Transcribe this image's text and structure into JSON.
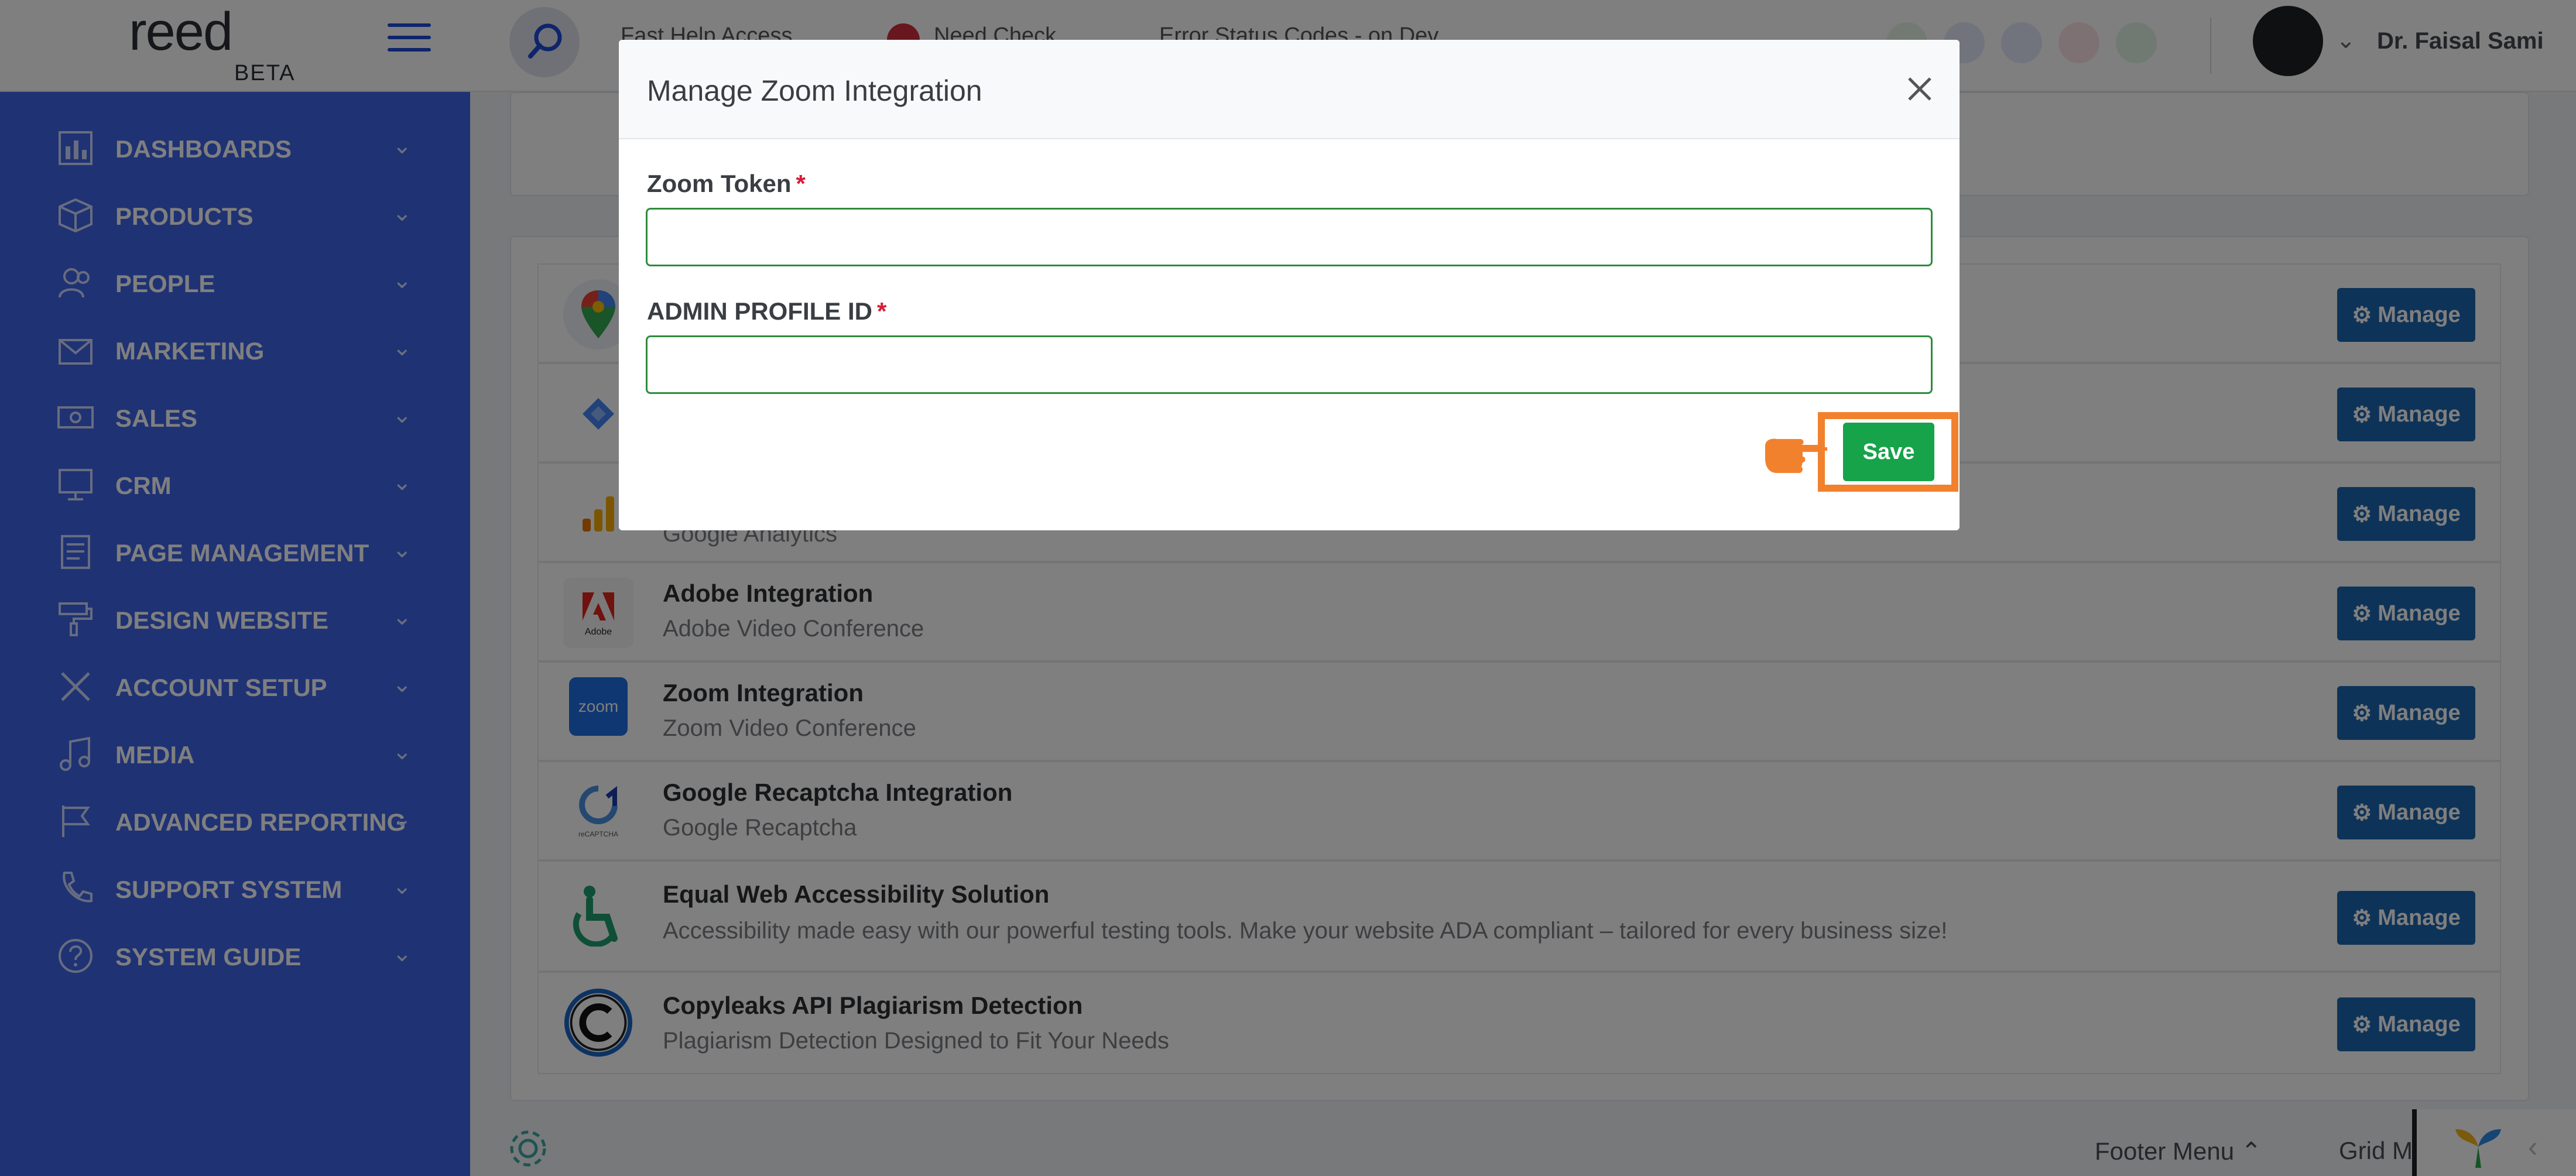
{
  "app": {
    "logo_text": "reed",
    "logo_badge": "BETA",
    "quick_links": [
      "Fast Help Access",
      "Need Check",
      "Error Status Codes - on Dev"
    ],
    "user_name": "Dr. Faisal Sami"
  },
  "sidebar": {
    "items": [
      {
        "label": "DASHBOARDS",
        "icon": "dashboard-icon"
      },
      {
        "label": "PRODUCTS",
        "icon": "box-icon"
      },
      {
        "label": "PEOPLE",
        "icon": "people-icon"
      },
      {
        "label": "MARKETING",
        "icon": "mail-icon"
      },
      {
        "label": "SALES",
        "icon": "cash-icon"
      },
      {
        "label": "CRM",
        "icon": "monitor-icon"
      },
      {
        "label": "PAGE MANAGEMENT",
        "icon": "page-icon"
      },
      {
        "label": "DESIGN WEBSITE",
        "icon": "paint-roller-icon"
      },
      {
        "label": "ACCOUNT SETUP",
        "icon": "tools-icon"
      },
      {
        "label": "MEDIA",
        "icon": "music-icon"
      },
      {
        "label": "ADVANCED REPORTING",
        "icon": "flag-icon"
      },
      {
        "label": "SUPPORT SYSTEM",
        "icon": "phone-icon"
      },
      {
        "label": "SYSTEM GUIDE",
        "icon": "help-icon"
      }
    ]
  },
  "integrations": {
    "manage_label": "Manage",
    "rows": [
      {
        "title": "",
        "desc": "",
        "logo": "google-maps-icon"
      },
      {
        "title": "",
        "desc": "",
        "logo": "google-tag-icon"
      },
      {
        "title": "",
        "desc": "Google Analytics",
        "logo": "google-analytics-icon"
      },
      {
        "title": "Adobe Integration",
        "desc": "Adobe Video Conference",
        "logo": "adobe-icon"
      },
      {
        "title": "Zoom Integration",
        "desc": "Zoom Video Conference",
        "logo": "zoom-icon"
      },
      {
        "title": "Google Recaptcha Integration",
        "desc": "Google Recaptcha",
        "logo": "recaptcha-icon"
      },
      {
        "title": "Equal Web Accessibility Solution",
        "desc": "Accessibility made easy with our powerful testing tools. Make your website ADA compliant – tailored for every business size!",
        "logo": "accessibility-icon"
      },
      {
        "title": "Copyleaks API Plagiarism Detection",
        "desc": "Plagiarism Detection Designed to Fit Your Needs",
        "logo": "copyleaks-icon"
      }
    ]
  },
  "footer": {
    "footer_menu": "Footer Menu",
    "grid_menu": "Grid Menu"
  },
  "modal": {
    "title": "Manage Zoom Integration",
    "fields": [
      {
        "label": "Zoom Token",
        "required_mark": "*",
        "value": ""
      },
      {
        "label": "ADMIN PROFILE ID",
        "required_mark": "*",
        "value": ""
      }
    ],
    "save_label": "Save",
    "zoom_logo_text": "zoom",
    "adobe_logo_text": "Adobe",
    "recaptcha_logo_text": "reCAPTCHA"
  },
  "colors": {
    "sidebar": "#3f64e8",
    "manage_button": "#1d66b0",
    "save_button": "#16a34a",
    "highlight": "#f2812d"
  }
}
